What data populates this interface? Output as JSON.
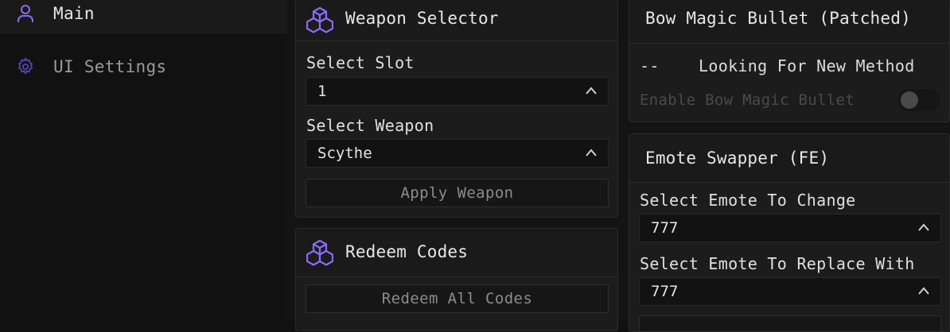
{
  "sidebar": {
    "items": [
      {
        "label": "Main",
        "icon": "user-icon",
        "active": true
      },
      {
        "label": "UI Settings",
        "icon": "gear-icon",
        "active": false
      }
    ]
  },
  "weapon_selector": {
    "title": "Weapon Selector",
    "icon": "cube-cluster-icon",
    "slot_label": "Select Slot",
    "slot_value": "1",
    "weapon_label": "Select Weapon",
    "weapon_value": "Scythe",
    "apply_label": "Apply Weapon"
  },
  "redeem_codes": {
    "title": "Redeem Codes",
    "icon": "cube-cluster-icon",
    "redeem_label": "Redeem All Codes"
  },
  "bow_magic": {
    "title": "Bow Magic Bullet (Patched)",
    "status_text": "--    Looking For New Method",
    "toggle_label": "Enable Bow Magic Bullet",
    "toggle_on": false
  },
  "emote_swapper": {
    "title": "Emote Swapper (FE)",
    "change_label": "Select Emote To Change",
    "change_value": "777",
    "replace_label": "Select Emote To Replace With",
    "replace_value": "777"
  },
  "colors": {
    "accent": "#7b5cff",
    "background": "#111111",
    "card": "#1c1c1c"
  }
}
